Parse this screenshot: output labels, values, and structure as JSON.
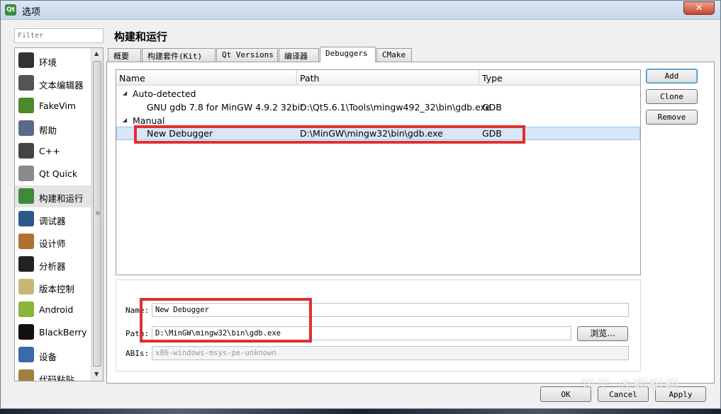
{
  "window": {
    "title": "选项",
    "close_glyph": "✕",
    "app_icon": "qt-icon"
  },
  "filter": {
    "placeholder": "Filter"
  },
  "sidebar": {
    "items": [
      {
        "label": "环境",
        "icon": "monitor-icon",
        "color": "#333333"
      },
      {
        "label": "文本编辑器",
        "icon": "text-editor-icon",
        "color": "#555555"
      },
      {
        "label": "FakeVim",
        "icon": "fakevim-icon",
        "color": "#4a8a2a"
      },
      {
        "label": "帮助",
        "icon": "help-icon",
        "color": "#5a6a8a"
      },
      {
        "label": "C++",
        "icon": "braces-icon",
        "color": "#444444"
      },
      {
        "label": "Qt Quick",
        "icon": "paper-plane-icon",
        "color": "#8a8a8a"
      },
      {
        "label": "构建和运行",
        "icon": "build-run-icon",
        "color": "#3f8a3a"
      },
      {
        "label": "调试器",
        "icon": "debugger-icon",
        "color": "#2a5a8a"
      },
      {
        "label": "设计师",
        "icon": "designer-icon",
        "color": "#b07030"
      },
      {
        "label": "分析器",
        "icon": "analyzer-icon",
        "color": "#222222"
      },
      {
        "label": "版本控制",
        "icon": "version-control-icon",
        "color": "#c8b878"
      },
      {
        "label": "Android",
        "icon": "android-icon",
        "color": "#8ab43a"
      },
      {
        "label": "BlackBerry",
        "icon": "blackberry-icon",
        "color": "#111111"
      },
      {
        "label": "设备",
        "icon": "device-icon",
        "color": "#3a6aaa"
      },
      {
        "label": "代码粘贴",
        "icon": "code-paste-icon",
        "color": "#a08040"
      }
    ],
    "active_index": 6
  },
  "page": {
    "title": "构建和运行"
  },
  "tabs": [
    {
      "label": "概要"
    },
    {
      "label": "构建套件(Kit)"
    },
    {
      "label": "Qt Versions"
    },
    {
      "label": "编译器"
    },
    {
      "label": "Debuggers"
    },
    {
      "label": "CMake"
    }
  ],
  "active_tab": "Debuggers",
  "tree": {
    "columns": [
      "Name",
      "Path",
      "Type"
    ],
    "groups": [
      {
        "label": "Auto-detected",
        "rows": [
          {
            "name": "GNU gdb 7.8 for MinGW 4.9.2 32bit",
            "path": "D:\\Qt5.6.1\\Tools\\mingw492_32\\bin\\gdb.exe",
            "type": "GDB"
          }
        ]
      },
      {
        "label": "Manual",
        "rows": [
          {
            "name": "New Debugger",
            "path": "D:\\MinGW\\mingw32\\bin\\gdb.exe",
            "type": "GDB",
            "selected": true
          }
        ]
      }
    ]
  },
  "side_buttons": {
    "add": "Add",
    "clone": "Clone",
    "remove": "Remove"
  },
  "details": {
    "name_label": "Name:",
    "name_value": "New Debugger",
    "path_label": "Path:",
    "path_value": "D:\\MinGW\\mingw32\\bin\\gdb.exe",
    "browse_label": "浏览...",
    "abis_label": "ABIs:",
    "abis_value": "x86-windows-msys-pe-unknown"
  },
  "dialog_buttons": {
    "ok": "OK",
    "cancel": "Cancel",
    "apply": "Apply"
  },
  "watermark": "知乎 @明明明",
  "colors": {
    "annotation_red": "#e03030",
    "selection": "#d7e7f8"
  }
}
